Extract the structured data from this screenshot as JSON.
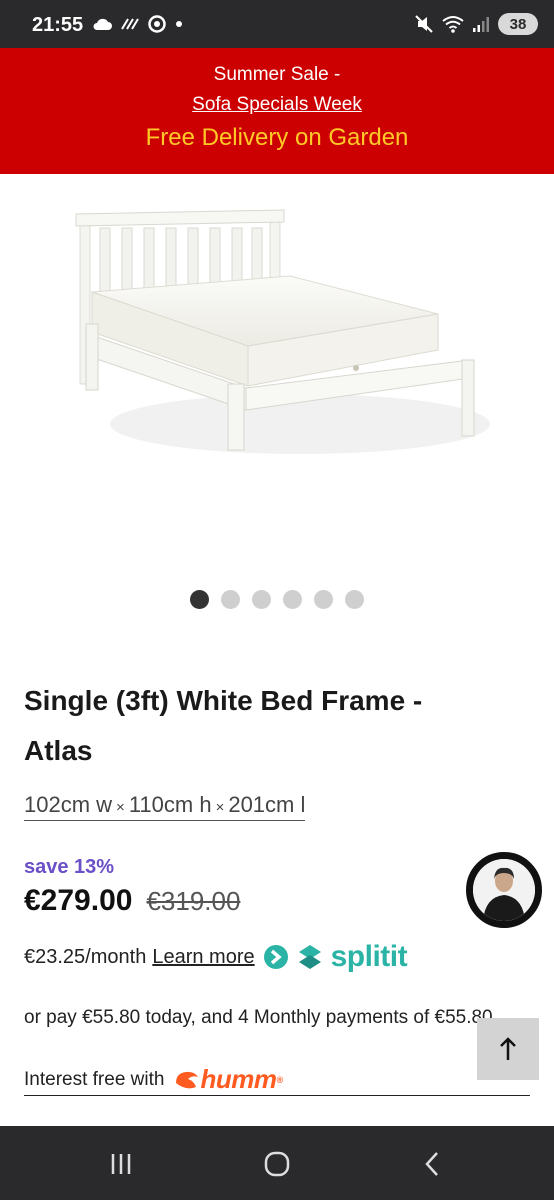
{
  "status_bar": {
    "time": "21:55",
    "battery": "38"
  },
  "promo": {
    "line1": "Summer Sale -",
    "line2": "Sofa Specials Week",
    "line3": "Free Delivery on Garden"
  },
  "carousel": {
    "count": 6,
    "active_index": 0
  },
  "product": {
    "title": "Single (3ft) White Bed Frame - Atlas",
    "dim_w": "102cm w",
    "dim_h": "110cm h",
    "dim_l": "201cm l",
    "dim_sep": "×",
    "save": "save 13%",
    "price": "€279.00",
    "was_price": "€319.00"
  },
  "splitit": {
    "monthly": "€23.25/month",
    "learn_more": "Learn more",
    "brand": "splitit"
  },
  "humm": {
    "text": "or pay €55.80 today, and 4 Monthly payments of €55.80",
    "label": "Interest free with",
    "brand": "humm"
  },
  "colors": {
    "banner": "#cc0000",
    "banner_accent": "#ffc928",
    "save": "#6a4fc8",
    "splitit": "#2bb4a6",
    "humm": "#ff5a1f"
  }
}
